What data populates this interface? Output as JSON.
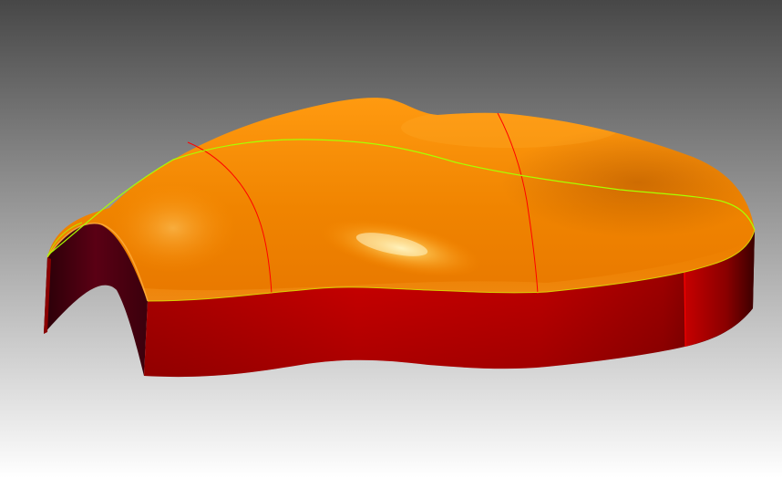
{
  "viewport": {
    "background": {
      "top": "#474747",
      "bottom": "#ffffff"
    },
    "model": {
      "surface_color": "#ff8a00",
      "surface_highlight": "#ffe9a0",
      "wall_color": "#d80000",
      "wall_dark": "#4a0000",
      "inner_color": "#5a0010",
      "red_edge_color": "#ff0000",
      "green_edge_color": "#a8ff00",
      "yellow_edge_color": "#ffd400"
    }
  }
}
